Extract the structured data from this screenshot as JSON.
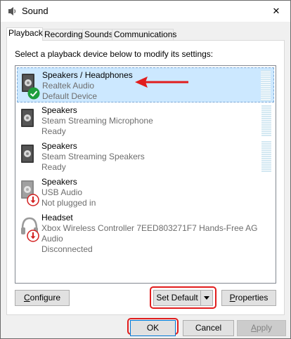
{
  "window": {
    "title": "Sound",
    "close_symbol": "✕"
  },
  "tabs": [
    {
      "label": "Playback",
      "active": true
    },
    {
      "label": "Recording",
      "active": false
    },
    {
      "label": "Sounds",
      "active": false
    },
    {
      "label": "Communications",
      "active": false
    }
  ],
  "instruction": "Select a playback device below to modify its settings:",
  "devices": [
    {
      "name": "Speakers / Headphones",
      "driver": "Realtek Audio",
      "status": "Default Device",
      "icon": "speaker-icon",
      "badge": "default-check-badge",
      "selected": true
    },
    {
      "name": "Speakers",
      "driver": "Steam Streaming Microphone",
      "status": "Ready",
      "icon": "speaker-icon",
      "badge": "",
      "selected": false
    },
    {
      "name": "Speakers",
      "driver": "Steam Streaming Speakers",
      "status": "Ready",
      "icon": "speaker-icon",
      "badge": "",
      "selected": false
    },
    {
      "name": "Speakers",
      "driver": "USB Audio",
      "status": "Not plugged in",
      "icon": "speaker-icon",
      "badge": "unplugged-badge",
      "selected": false
    },
    {
      "name": "Headset",
      "driver": "Xbox Wireless Controller 7EED803271F7 Hands-Free AG Audio",
      "status": "Disconnected",
      "icon": "headset-icon",
      "badge": "unplugged-badge",
      "selected": false
    }
  ],
  "buttons": {
    "configure": "Configure",
    "set_default": "Set Default",
    "properties": "Properties",
    "ok": "OK",
    "cancel": "Cancel",
    "apply": "Apply"
  },
  "colors": {
    "highlight": "#cce8ff",
    "annotation_red": "#e11d1d",
    "check_green": "#1e9e3b"
  }
}
